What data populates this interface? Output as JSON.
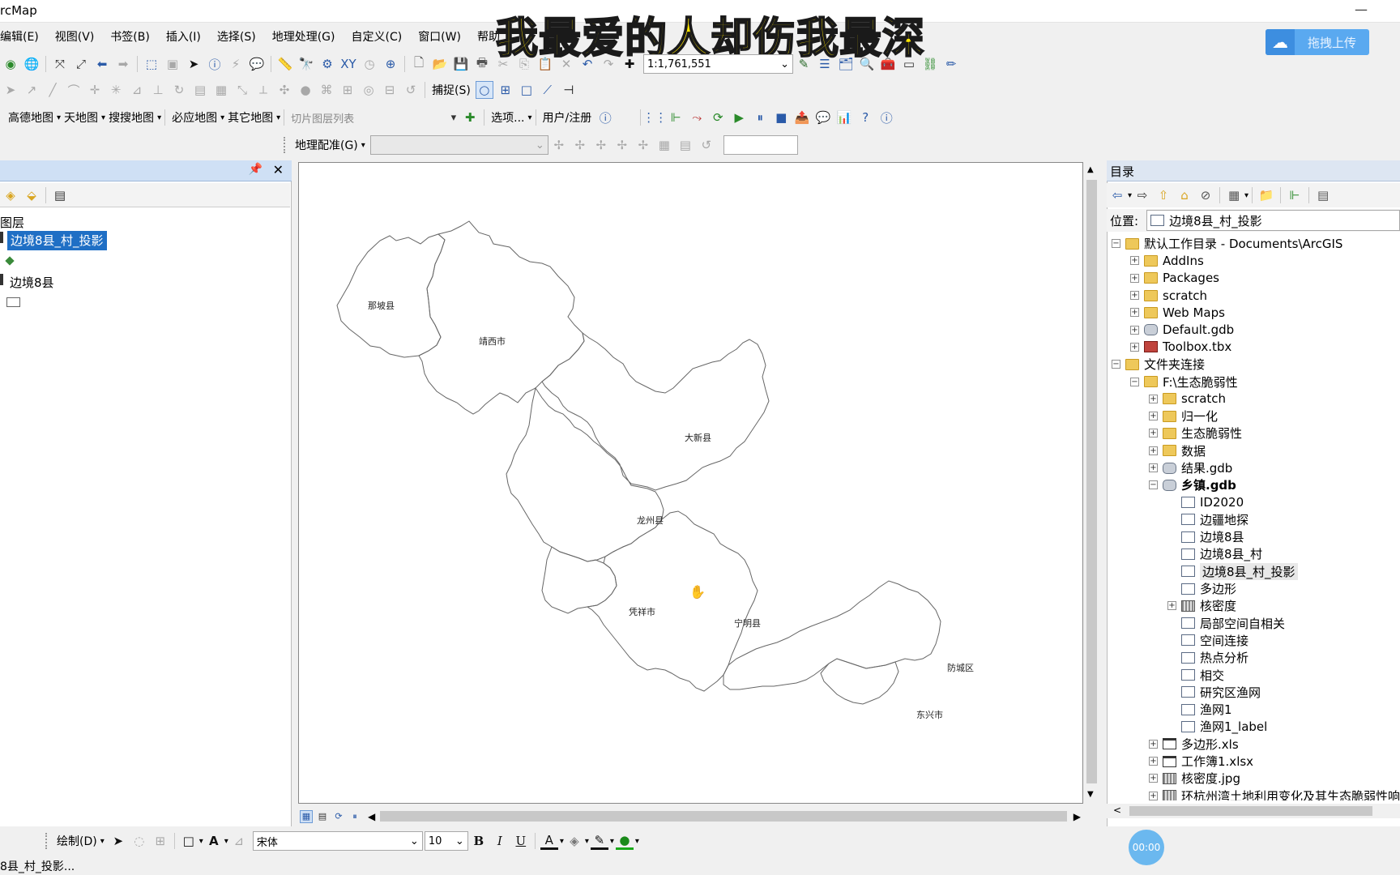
{
  "window": {
    "title": "rcMap"
  },
  "overlay": {
    "caption": "我最爱的人却伤我最深",
    "upload_label": "拖拽上传",
    "timer": "00:00"
  },
  "menu": [
    "编辑(E)",
    "视图(V)",
    "书签(B)",
    "插入(I)",
    "选择(S)",
    "地理处理(G)",
    "自定义(C)",
    "窗口(W)",
    "帮助"
  ],
  "toolbar": {
    "scale": "1:1,761,551",
    "snapping_label": "捕捉(S)",
    "basemaps": [
      "高德地图",
      "天地图",
      "搜搜地图",
      "必应地图",
      "其它地图"
    ],
    "tile_layer_placeholder": "切片图层列表",
    "options_label": "选项...",
    "user_label": "用户/注册",
    "georef_label": "地理配准(G)"
  },
  "toc": {
    "heading": "图层",
    "layers": [
      {
        "name": "边境8县_村_投影",
        "selected": true,
        "symbol": "point"
      },
      {
        "name": "边境8县",
        "selected": false,
        "symbol": "polygon"
      }
    ]
  },
  "map": {
    "labels": [
      "那坡县",
      "靖西市",
      "大新县",
      "龙州县",
      "凭祥市",
      "宁明县",
      "防城区",
      "东兴市"
    ]
  },
  "catalog": {
    "title": "目录",
    "location_label": "位置:",
    "location_value": "边境8县_村_投影",
    "tree": [
      {
        "label": "默认工作目录 - Documents\\ArcGIS",
        "level": 0,
        "exp": "−",
        "icon": "fold",
        "bold": false
      },
      {
        "label": "AddIns",
        "level": 1,
        "exp": "+",
        "icon": "fold",
        "bold": false
      },
      {
        "label": "Packages",
        "level": 1,
        "exp": "+",
        "icon": "fold",
        "bold": false
      },
      {
        "label": "scratch",
        "level": 1,
        "exp": "+",
        "icon": "fold",
        "bold": false
      },
      {
        "label": "Web Maps",
        "level": 1,
        "exp": "+",
        "icon": "fold",
        "bold": false
      },
      {
        "label": "Default.gdb",
        "level": 1,
        "exp": "+",
        "icon": "gdb",
        "bold": false
      },
      {
        "label": "Toolbox.tbx",
        "level": 1,
        "exp": "+",
        "icon": "tbx",
        "bold": false
      },
      {
        "label": "文件夹连接",
        "level": 0,
        "exp": "−",
        "icon": "fold",
        "bold": false
      },
      {
        "label": "F:\\生态脆弱性",
        "level": 1,
        "exp": "−",
        "icon": "fold",
        "bold": false
      },
      {
        "label": "scratch",
        "level": 2,
        "exp": "+",
        "icon": "fold",
        "bold": false
      },
      {
        "label": "归一化",
        "level": 2,
        "exp": "+",
        "icon": "fold",
        "bold": false
      },
      {
        "label": "生态脆弱性",
        "level": 2,
        "exp": "+",
        "icon": "fold",
        "bold": false
      },
      {
        "label": "数据",
        "level": 2,
        "exp": "+",
        "icon": "fold",
        "bold": false
      },
      {
        "label": "结果.gdb",
        "level": 2,
        "exp": "+",
        "icon": "gdb",
        "bold": false
      },
      {
        "label": "乡镇.gdb",
        "level": 2,
        "exp": "−",
        "icon": "gdb",
        "bold": true
      },
      {
        "label": "ID2020",
        "level": 3,
        "exp": "",
        "icon": "fc",
        "bold": false
      },
      {
        "label": "边疆地探",
        "level": 3,
        "exp": "",
        "icon": "fc",
        "bold": false
      },
      {
        "label": "边境8县",
        "level": 3,
        "exp": "",
        "icon": "fc",
        "bold": false
      },
      {
        "label": "边境8县_村",
        "level": 3,
        "exp": "",
        "icon": "pt",
        "bold": false
      },
      {
        "label": "边境8县_村_投影",
        "level": 3,
        "exp": "",
        "icon": "pt",
        "bold": false,
        "highlight": true
      },
      {
        "label": "多边形",
        "level": 3,
        "exp": "",
        "icon": "fc",
        "bold": false
      },
      {
        "label": "核密度",
        "level": 3,
        "exp": "+",
        "icon": "rst",
        "bold": false
      },
      {
        "label": "局部空间自相关",
        "level": 3,
        "exp": "",
        "icon": "fc",
        "bold": false
      },
      {
        "label": "空间连接",
        "level": 3,
        "exp": "",
        "icon": "fc",
        "bold": false
      },
      {
        "label": "热点分析",
        "level": 3,
        "exp": "",
        "icon": "fc",
        "bold": false
      },
      {
        "label": "相交",
        "level": 3,
        "exp": "",
        "icon": "fc",
        "bold": false
      },
      {
        "label": "研究区渔网",
        "level": 3,
        "exp": "",
        "icon": "fc",
        "bold": false
      },
      {
        "label": "渔网1",
        "level": 3,
        "exp": "",
        "icon": "fc",
        "bold": false
      },
      {
        "label": "渔网1_label",
        "level": 3,
        "exp": "",
        "icon": "pt",
        "bold": false
      },
      {
        "label": "多边形.xls",
        "level": 2,
        "exp": "+",
        "icon": "tbl",
        "bold": false
      },
      {
        "label": "工作簿1.xlsx",
        "level": 2,
        "exp": "+",
        "icon": "tbl",
        "bold": false
      },
      {
        "label": "核密度.jpg",
        "level": 2,
        "exp": "+",
        "icon": "rst",
        "bold": false
      },
      {
        "label": "环杭州湾土地利用变化及其生态脆弱性响",
        "level": 2,
        "exp": "+",
        "icon": "rst",
        "bold": false
      }
    ]
  },
  "drawbar": {
    "draw_label": "绘制(D)",
    "font_name": "宋体",
    "font_size": "10"
  },
  "status": {
    "text": "8县_村_投影..."
  },
  "colors": {
    "accent": "#0a64c8",
    "selection": "#1f6fc5",
    "map_outline": "#666666"
  }
}
